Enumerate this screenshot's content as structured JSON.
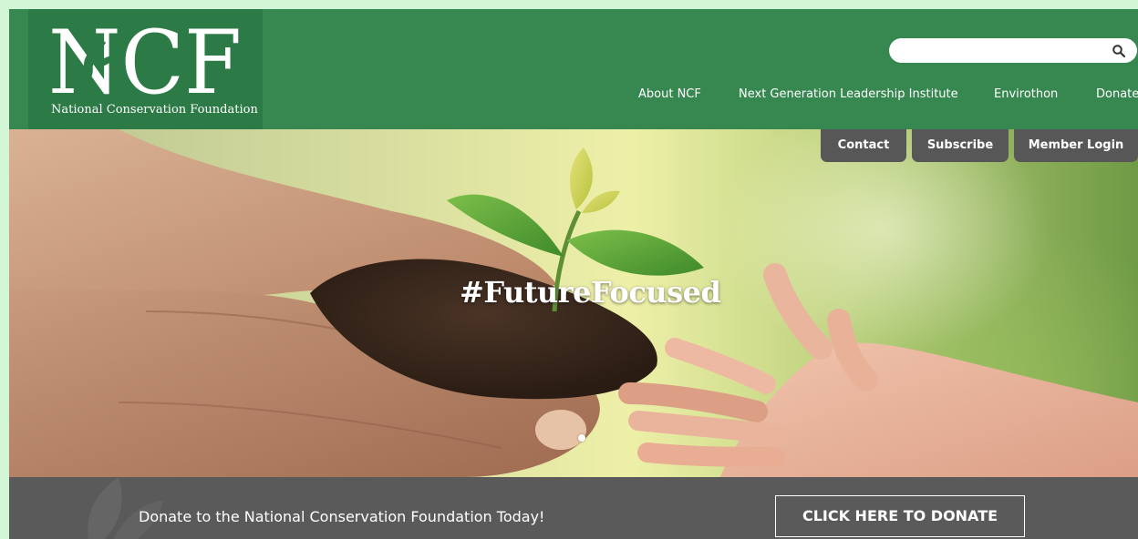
{
  "header": {
    "logo_text": "NCF",
    "logo_tagline": "National Conservation Foundation",
    "search": {
      "value": "",
      "placeholder": ""
    },
    "nav": [
      {
        "label": "About NCF"
      },
      {
        "label": "Next Generation Leadership Institute"
      },
      {
        "label": "Envirothon"
      },
      {
        "label": "Donate"
      }
    ],
    "utility": [
      {
        "label": "Contact"
      },
      {
        "label": "Subscribe"
      },
      {
        "label": "Member Login"
      }
    ]
  },
  "hero": {
    "tagline": "#FutureFocused"
  },
  "banner": {
    "text": "Donate to the National Conservation Foundation Today!",
    "button_label": "CLICK HERE TO DONATE"
  },
  "icons": {
    "search": "search-icon",
    "leaf": "leaf-icon"
  },
  "colors": {
    "header_green": "#368750",
    "logo_green": "#2c7a45",
    "tab_gray": "#575757",
    "banner_gray": "#5a5a5a",
    "text_white": "#ffffff"
  }
}
